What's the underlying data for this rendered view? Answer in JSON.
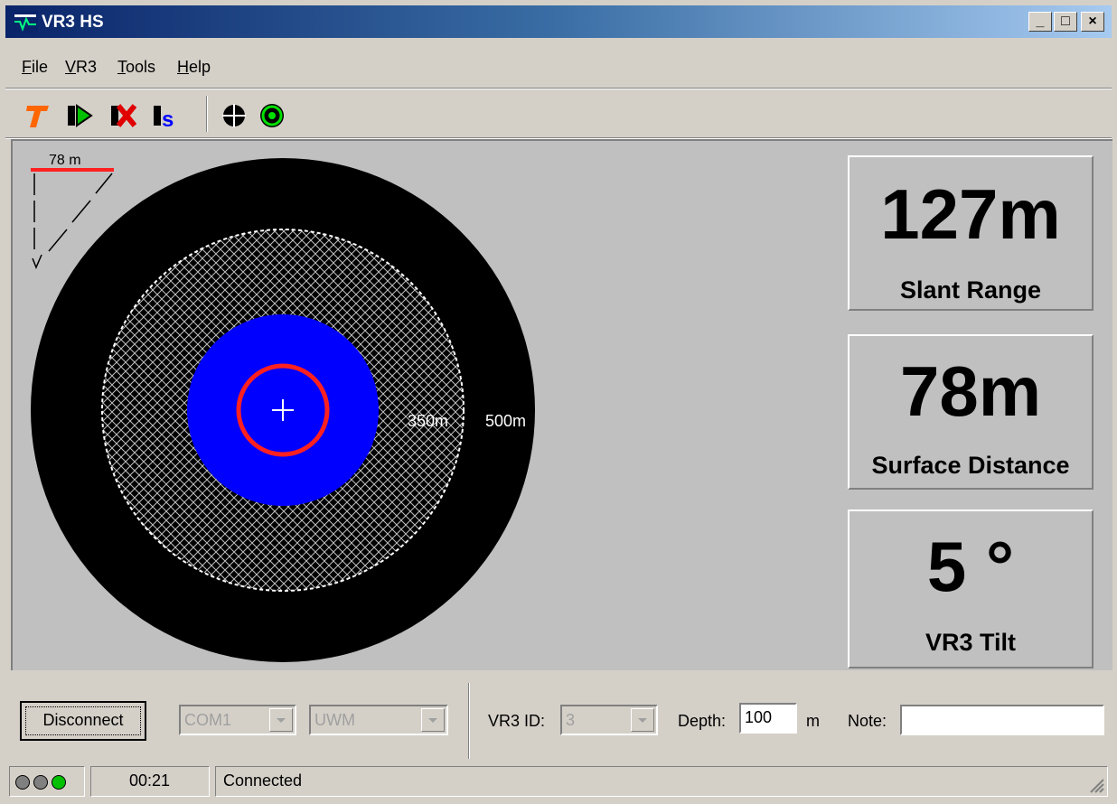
{
  "window": {
    "title": "VR3 HS",
    "controls": {
      "minimize": "_",
      "maximize": "□",
      "close": "×"
    }
  },
  "menu": {
    "file": {
      "label": "File",
      "accel": "F",
      "rest": "ile"
    },
    "vr3": {
      "label": "VR3",
      "accel": "V",
      "rest": "R3"
    },
    "tools": {
      "label": "Tools",
      "accel": "T",
      "rest": "ools"
    },
    "help": {
      "label": "Help",
      "accel": "H",
      "rest": "elp"
    }
  },
  "toolbar": {
    "icons": [
      "t-icon",
      "record-play-icon",
      "stop-red-x-icon",
      "s-icon",
      "crosshair-icon",
      "target-rings-icon"
    ]
  },
  "plot": {
    "scale_label": "78 m",
    "ring_labels": [
      "350m",
      "500m"
    ]
  },
  "readouts": {
    "slant_range": {
      "value": "127m",
      "label": "Slant Range"
    },
    "surface_distance": {
      "value": "78m",
      "label": "Surface Distance"
    },
    "tilt": {
      "value": "5 °",
      "label": "VR3 Tilt"
    }
  },
  "controls": {
    "disconnect_label": "Disconnect",
    "port_value": "COM1",
    "mode_value": "UWM",
    "vr3_id_label": "VR3 ID:",
    "vr3_id_value": "3",
    "depth_label": "Depth:",
    "depth_value": "100",
    "depth_unit": "m",
    "note_label": "Note:",
    "note_value": ""
  },
  "status": {
    "time": "00:21",
    "message": "Connected"
  },
  "colors": {
    "titlebar_start": "#0a246a",
    "blue_zone": "#0000ff",
    "red_ring": "#ff2020",
    "accent_orange": "#ff6600",
    "led_on": "#00c000"
  }
}
